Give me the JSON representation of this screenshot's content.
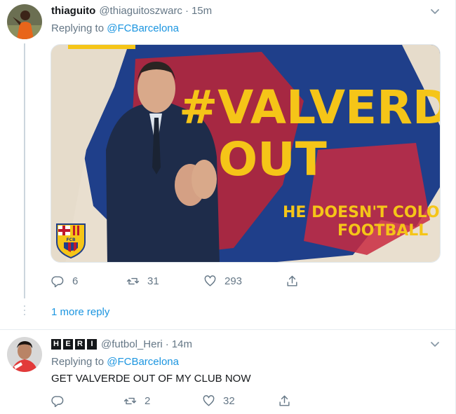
{
  "tweets": [
    {
      "name": "thiaguito",
      "handle": "@thiaguitoszwarc",
      "dot": "·",
      "time": "15m",
      "replying_prefix": "Replying to",
      "replying_to": "@FCBarcelona",
      "image": {
        "headline_line1": "#VALVERDE",
        "headline_line2": "OUT",
        "sub_line1": "HE DOESN'T COLOR",
        "sub_line2": "FOOTBALL",
        "crest_text": "FCB"
      },
      "actions": {
        "replies": "6",
        "retweets": "31",
        "likes": "293"
      },
      "more_replies": "1 more reply"
    },
    {
      "name_chars": [
        "H",
        "E",
        "R",
        "I"
      ],
      "handle": "@futbol_Heri",
      "dot": "·",
      "time": "14m",
      "replying_prefix": "Replying to",
      "replying_to": "@FCBarcelona",
      "text": "GET VALVERDE OUT OF MY CLUB NOW",
      "actions": {
        "replies": "",
        "retweets": "2",
        "likes": "32"
      }
    }
  ],
  "colors": {
    "link": "#1b95e0",
    "muted": "#657786",
    "divider": "#e6ecf0",
    "headline_yellow": "#f5c518"
  }
}
